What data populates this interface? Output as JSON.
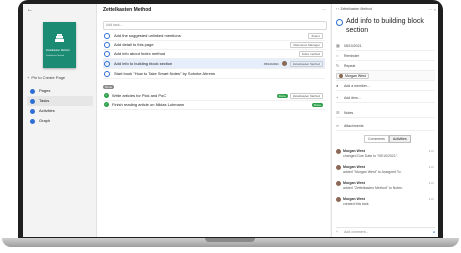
{
  "left": {
    "back_label": "Zettelkasten Method",
    "cover_title": "Zettelkasten Method",
    "cover_subtitle": "Zettelkasten Method",
    "create_page_label": "Pin to Create Page",
    "nav": [
      {
        "label": "Pages",
        "color": "#2f6fd3",
        "active": false
      },
      {
        "label": "Tasks",
        "color": "#2f6fd3",
        "active": true
      },
      {
        "label": "Activities",
        "color": "#2f6fd3",
        "active": false
      },
      {
        "label": "Graph",
        "color": "#2f6fd3",
        "active": false
      }
    ]
  },
  "middle": {
    "title": "Zettelkasten Method",
    "add_task_placeholder": "Add task...",
    "tasks": [
      {
        "label": "Add the suggested unlinked mentions",
        "tag": "Zotero",
        "date": "",
        "done": false
      },
      {
        "label": "Add detail to this page",
        "tag": "Reference Manager",
        "date": "",
        "done": false
      },
      {
        "label": "Add info about Index method",
        "tag": "Index method",
        "date": "",
        "done": false
      },
      {
        "label": "Add info to building block section",
        "tag": "Zettelkasten Method",
        "date": "05/10/2021",
        "done": false,
        "selected": true
      },
      {
        "label": "Start book \"How to Take Smart Notes\" by Sohnke Ahrens",
        "tag": "",
        "date": "",
        "done": false
      }
    ],
    "completed_label": "Done",
    "completed_tasks": [
      {
        "label": "Write articles for Pick and PoC",
        "tag": "Zettelkasten Method",
        "pill": "Done"
      },
      {
        "label": "Finish reading article on Niklas Luhmann",
        "tag": "",
        "pill": "Done"
      }
    ]
  },
  "right": {
    "breadcrumb": "Zettelkasten Method",
    "title": "Add info to building block section",
    "rows": {
      "due_date": "05/10/2021",
      "reminder": "Reminder",
      "repeat": "Repeat",
      "assignee": "Morgan West",
      "add_member": "Add a member...",
      "add_item": "Add item...",
      "notes": "Notes",
      "attachments": "Attachments"
    },
    "tabs": [
      "Comments",
      "Activities"
    ],
    "activities": [
      {
        "name": "Morgan West",
        "msg": "changed Due Date to \"05/10/2021\".",
        "time": "1 hr"
      },
      {
        "name": "Morgan West",
        "msg": "added \"Morgan West\" to Assigned To.",
        "time": "1 hr"
      },
      {
        "name": "Morgan West",
        "msg": "added \"Zettelkasten Method\" to Notes.",
        "time": "1 hr"
      },
      {
        "name": "Morgan West",
        "msg": "created this task.",
        "time": "1 hr"
      }
    ],
    "comment_placeholder": "Add comment..."
  }
}
